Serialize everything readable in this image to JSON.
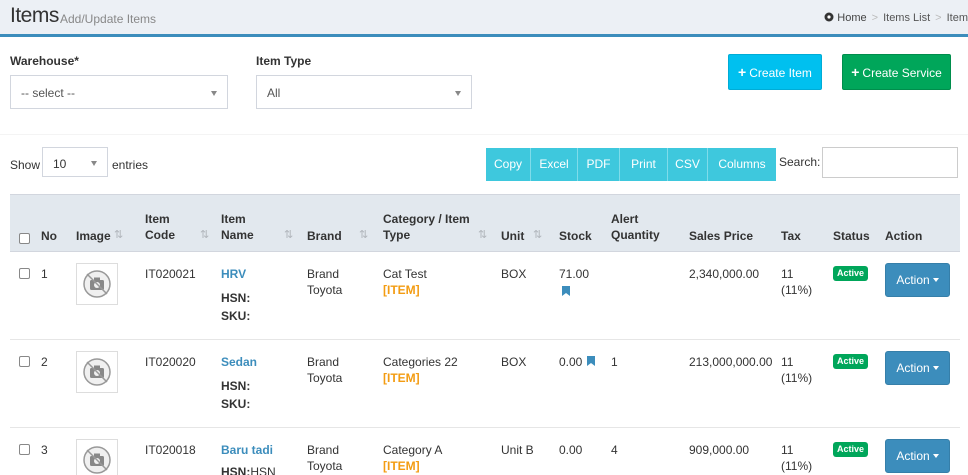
{
  "header": {
    "title": "Items",
    "subtitle": "Add/Update Items",
    "breadcrumb": [
      "Home",
      "Items List",
      "Item"
    ]
  },
  "filters": {
    "warehouse_label": "Warehouse*",
    "warehouse_value": "-- select --",
    "item_type_label": "Item Type",
    "item_type_value": "All"
  },
  "actions": {
    "create_item": "Create Item",
    "create_service": "Create Service"
  },
  "table_controls": {
    "show": "Show",
    "length": "10",
    "entries": "entries",
    "buttons": [
      "Copy",
      "Excel",
      "PDF",
      "Print",
      "CSV",
      "Columns"
    ],
    "search_label": "Search:"
  },
  "table": {
    "headers": [
      "No",
      "Image",
      "Item Code",
      "Item Name",
      "Brand",
      "Category / Item Type",
      "Unit",
      "Stock",
      "Alert Quantity",
      "Sales Price",
      "Tax",
      "Status",
      "Action"
    ],
    "header_lines": {
      "item_code": [
        "Item",
        "Code"
      ],
      "item_name": [
        "Item",
        "Name"
      ],
      "category": [
        "Category / Item",
        "Type"
      ],
      "alert": [
        "Alert",
        "Quantity"
      ]
    },
    "rows": [
      {
        "no": "1",
        "code": "IT020021",
        "name": "HRV",
        "hsn_label": "HSN:",
        "hsn_value": "",
        "sku_label": "SKU:",
        "brand": [
          "Brand",
          "Toyota"
        ],
        "category": "Cat Test",
        "type": "[ITEM]",
        "unit": "BOX",
        "stock": "71.00",
        "alert": "",
        "price": "2,340,000.00",
        "tax": [
          "11",
          "(11%)"
        ],
        "status": "Active",
        "action": "Action"
      },
      {
        "no": "2",
        "code": "IT020020",
        "name": "Sedan",
        "hsn_label": "HSN:",
        "hsn_value": "",
        "sku_label": "SKU:",
        "brand": [
          "Brand",
          "Toyota"
        ],
        "category": "Categories 22",
        "type": "[ITEM]",
        "unit": "BOX",
        "stock": "0.00",
        "alert": "1",
        "price": "213,000,000.00",
        "tax": [
          "11",
          "(11%)"
        ],
        "status": "Active",
        "action": "Action"
      },
      {
        "no": "3",
        "code": "IT020018",
        "name": "Baru tadi",
        "hsn_label": "HSN:",
        "hsn_value": "HSN",
        "sku_label": "",
        "brand": [
          "Brand",
          "Toyota"
        ],
        "category": "Category A",
        "type": "[ITEM]",
        "unit": "Unit B",
        "stock": "0.00",
        "alert": "4",
        "price": "909,000.00",
        "tax": [
          "11",
          "(11%)"
        ],
        "status": "Active",
        "action": "Action"
      }
    ]
  },
  "colors": {
    "primary": "#3c8dbc",
    "info": "#00c0ef",
    "success": "#00a65a",
    "warning": "#f39c12",
    "dt_button": "#3ec8dd"
  }
}
